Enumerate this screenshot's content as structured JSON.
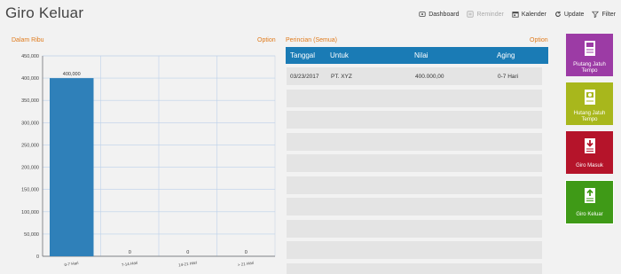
{
  "app": {
    "title": "Giro Keluar"
  },
  "toolbar": {
    "items": [
      {
        "label": "Dashboard",
        "icon": "dashboard-icon",
        "enabled": true
      },
      {
        "label": "Reminder",
        "icon": "reminder-icon",
        "enabled": false
      },
      {
        "label": "Kalender",
        "icon": "calendar-icon",
        "enabled": true
      },
      {
        "label": "Update",
        "icon": "refresh-icon",
        "enabled": true
      },
      {
        "label": "Filter",
        "icon": "filter-icon",
        "enabled": true
      }
    ]
  },
  "chart_panel": {
    "label": "Dalam Ribu",
    "option": "Option"
  },
  "table_panel": {
    "label": "Perincian (Semua)",
    "option": "Option"
  },
  "chart_data": {
    "type": "bar",
    "categories": [
      "0-7 Hari",
      "7-14 Hari",
      "14-21 Hari",
      "> 21 Hari"
    ],
    "values": [
      400000,
      0,
      0,
      0
    ],
    "data_labels": [
      "400,000",
      "0",
      "0",
      "0"
    ],
    "yticks": [
      "450,000",
      "400,000",
      "350,000",
      "300,000",
      "250,000",
      "200,000",
      "150,000",
      "100,000",
      "50,000",
      "0"
    ],
    "ylim": [
      0,
      450000
    ],
    "grid": true,
    "bar_color": "#2f80b9"
  },
  "table": {
    "columns": [
      "Tanggal",
      "Untuk",
      "Nilai",
      "Aging"
    ],
    "rows": [
      [
        "03/23/2017",
        "PT. XYZ",
        "400.000,00",
        "0-7 Hari"
      ]
    ],
    "empty_rows": 9
  },
  "tiles": [
    {
      "label": "Piutang Jatuh Tempo",
      "color": "#9c3ba5",
      "icon": "receivable-icon"
    },
    {
      "label": "Hutang Jatuh Tempo",
      "color": "#a8b71c",
      "icon": "payable-icon"
    },
    {
      "label": "Giro Masuk",
      "color": "#b5142a",
      "icon": "giro-in-icon"
    },
    {
      "label": "Giro Keluar",
      "color": "#3f9a17",
      "icon": "giro-out-icon",
      "active": true
    }
  ]
}
